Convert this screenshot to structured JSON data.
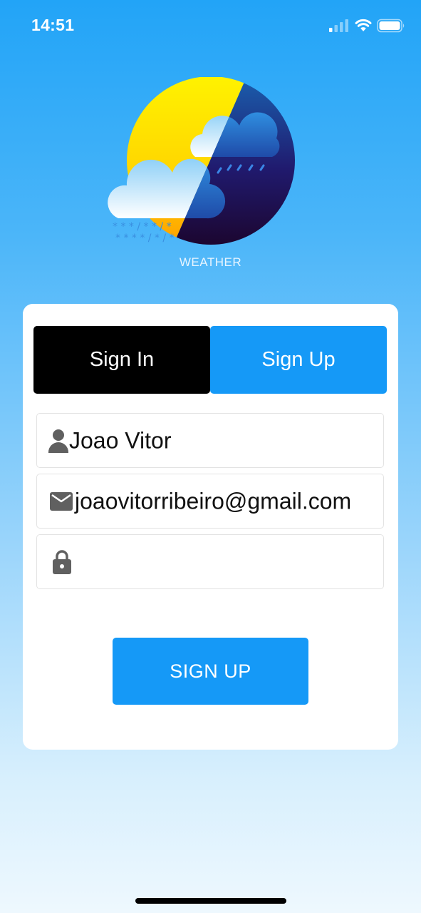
{
  "status_bar": {
    "time": "14:51",
    "icons": [
      "signal-icon",
      "wifi-icon",
      "battery-icon"
    ]
  },
  "logo": {
    "label": "WEATHER",
    "icon": "weather-logo-icon"
  },
  "auth": {
    "tabs": [
      {
        "label": "Sign In",
        "active": true
      },
      {
        "label": "Sign Up",
        "active": false
      }
    ],
    "fields": {
      "name": {
        "value": "Joao Vitor",
        "icon": "user-icon"
      },
      "email": {
        "value": "joaovitorribeiro@gmail.com",
        "icon": "mail-icon"
      },
      "password": {
        "value": "",
        "icon": "lock-icon"
      }
    },
    "submit_label": "SIGN UP"
  },
  "colors": {
    "accent": "#1599f7",
    "active_tab": "#000000",
    "background_top": "#22a4f7",
    "background_bottom": "#eef8fe",
    "card": "#ffffff"
  }
}
